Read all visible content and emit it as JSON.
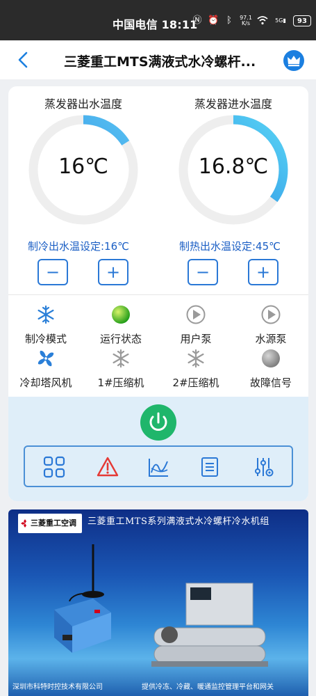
{
  "statusbar": {
    "carrier_time": "中国电信 18:11",
    "speed_value": "97.1",
    "speed_unit": "K/s",
    "signal": "5G",
    "battery": "93"
  },
  "header": {
    "title": "三菱重工MTS满液式水冷螺杆..."
  },
  "gauges": [
    {
      "label": "蒸发器出水温度",
      "value": "16℃",
      "fill": 0.16,
      "setpoint": "制冷出水温设定:16℃"
    },
    {
      "label": "蒸发器进水温度",
      "value": "16.8℃",
      "fill": 0.35,
      "setpoint": "制热出水温设定:45℃"
    }
  ],
  "stepper": {
    "minus": "−",
    "plus": "+"
  },
  "status": [
    {
      "label": "制冷模式",
      "icon": "snowflake-icon",
      "color": "#2a7fd8"
    },
    {
      "label": "运行状态",
      "icon": "status-light-icon",
      "color": "#38b000"
    },
    {
      "label": "用户泵",
      "icon": "pump-play-icon",
      "color": "#9a9a9a"
    },
    {
      "label": "水源泵",
      "icon": "pump-play-icon",
      "color": "#9a9a9a"
    },
    {
      "label": "冷却塔风机",
      "icon": "fan-icon",
      "color": "#2a7fd8"
    },
    {
      "label": "1#压缩机",
      "icon": "snowflake-icon",
      "color": "#9a9a9a"
    },
    {
      "label": "2#压缩机",
      "icon": "snowflake-icon",
      "color": "#9a9a9a"
    },
    {
      "label": "故障信号",
      "icon": "fault-light-icon",
      "color": "#8c8c8c"
    }
  ],
  "banner": {
    "logo": "三菱重工空调",
    "title": "三菱重工MTS系列满液式水冷螺杆冷水机组",
    "footer_company": "深圳市科特时控技术有限公司",
    "footer_service": "提供冷冻、冷藏、暖通监控管理平台和网关"
  },
  "colors": {
    "accent": "#2a78d6",
    "power": "#1fb66b",
    "alarm": "#e53935"
  }
}
